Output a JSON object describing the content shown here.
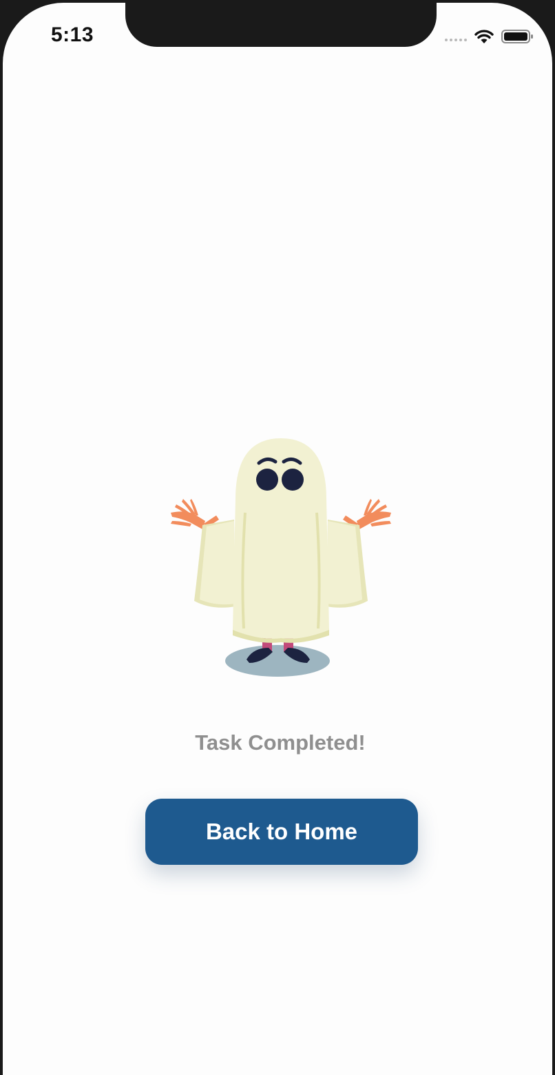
{
  "status_bar": {
    "time": "5:13",
    "icons": [
      "signal-icon",
      "wifi-icon",
      "battery-icon"
    ]
  },
  "illustration": {
    "icon": "ghost-illustration"
  },
  "message": "Task Completed!",
  "button": {
    "label": "Back to Home"
  },
  "colors": {
    "button": "#1e5a8f",
    "message": "#8f8f8f",
    "ghost": "#f2f1d2",
    "hands": "#f28c5c"
  }
}
